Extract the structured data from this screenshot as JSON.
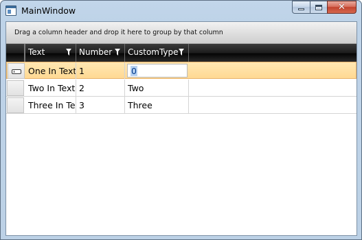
{
  "window": {
    "title": "MainWindow",
    "close_glyph": "✕",
    "icons": [
      "app-icon",
      "minimize-icon",
      "maximize-icon",
      "close-icon"
    ]
  },
  "group_panel": {
    "hint": "Drag a column header and drop it here to group by that column"
  },
  "grid": {
    "columns": [
      {
        "label": "Text",
        "icon": "filter-icon"
      },
      {
        "label": "Number",
        "icon": "filter-icon"
      },
      {
        "label": "CustomType",
        "icon": "filter-icon"
      }
    ],
    "rows": [
      {
        "text": "One In Text",
        "number": "1",
        "custom": "0",
        "current": true
      },
      {
        "text": "Two In Text",
        "number": "2",
        "custom": "Two",
        "current": false
      },
      {
        "text": "Three In Text",
        "number": "3",
        "custom": "Three",
        "current": false
      }
    ],
    "colors": {
      "header_bg": "#1d1d1d",
      "current_row": "#ffe2a8",
      "selection": "#b7d1f0"
    }
  }
}
